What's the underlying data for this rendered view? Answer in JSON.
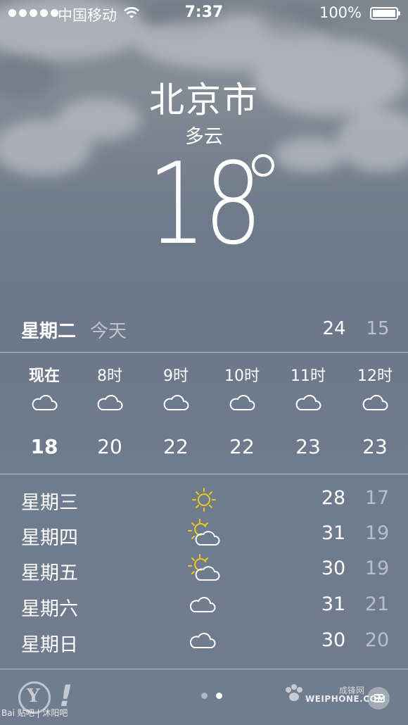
{
  "status_bar": {
    "carrier": "中国移动",
    "time": "7:37",
    "battery": "100%"
  },
  "current": {
    "city": "北京市",
    "condition": "多云",
    "temperature": "18"
  },
  "today": {
    "day": "星期二",
    "label": "今天",
    "high": "24",
    "low": "15"
  },
  "hourly": [
    {
      "time": "现在",
      "icon": "cloud-icon",
      "temp": "18"
    },
    {
      "time": "8时",
      "icon": "cloud-icon",
      "temp": "20"
    },
    {
      "time": "9时",
      "icon": "cloud-icon",
      "temp": "22"
    },
    {
      "time": "10时",
      "icon": "cloud-icon",
      "temp": "22"
    },
    {
      "time": "11时",
      "icon": "cloud-icon",
      "temp": "23"
    },
    {
      "time": "12时",
      "icon": "cloud-icon",
      "temp": "23"
    }
  ],
  "daily": [
    {
      "day": "星期三",
      "icon": "sun-icon",
      "high": "28",
      "low": "17"
    },
    {
      "day": "星期四",
      "icon": "partly-sunny-icon",
      "high": "31",
      "low": "19"
    },
    {
      "day": "星期五",
      "icon": "partly-sunny-icon",
      "high": "30",
      "low": "19"
    },
    {
      "day": "星期六",
      "icon": "cloud-icon",
      "high": "31",
      "low": "21"
    },
    {
      "day": "星期日",
      "icon": "cloud-icon",
      "high": "30",
      "low": "20"
    }
  ],
  "footer": {
    "yahoo_logo": "Y!",
    "watermark_left": "Bai 贴吧 | 沐阳吧",
    "watermark_right_cn": "成锋网",
    "watermark_right_en": "WEIPHONE.COM",
    "page_dots": 2,
    "active_page": 2
  },
  "colors": {
    "sun": "#f2c81a",
    "background": "#707d8f"
  }
}
